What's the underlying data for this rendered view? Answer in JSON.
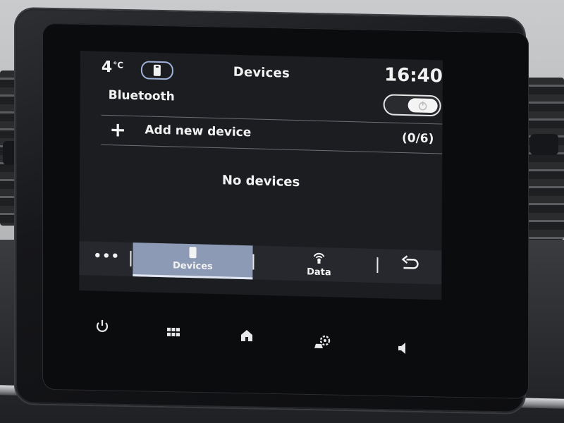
{
  "status": {
    "temperature": "4",
    "temperature_unit": "°C",
    "screen_title": "Devices",
    "time": "16:40"
  },
  "bluetooth": {
    "label": "Bluetooth",
    "toggle_on": true
  },
  "add_device": {
    "icon": "plus-icon",
    "label": "Add new device",
    "count": "(0/6)"
  },
  "device_list": {
    "empty_message": "No devices"
  },
  "tabbar": {
    "more_label": "•••",
    "tabs": [
      {
        "label": "Devices",
        "icon": "phone-icon",
        "active": true
      },
      {
        "label": "Data",
        "icon": "wireless-data-icon",
        "active": false
      }
    ],
    "back_icon": "back-arrow-icon"
  },
  "hardware_buttons": [
    {
      "icon": "power-icon"
    },
    {
      "icon": "apps-grid-icon"
    },
    {
      "icon": "home-icon"
    },
    {
      "icon": "car-settings-icon"
    },
    {
      "icon": "volume-icon"
    }
  ],
  "colors": {
    "screen_bg": "#1c1d21",
    "tab_active_bg": "#8d9ab6",
    "accent_outline": "#9fb1d9"
  }
}
